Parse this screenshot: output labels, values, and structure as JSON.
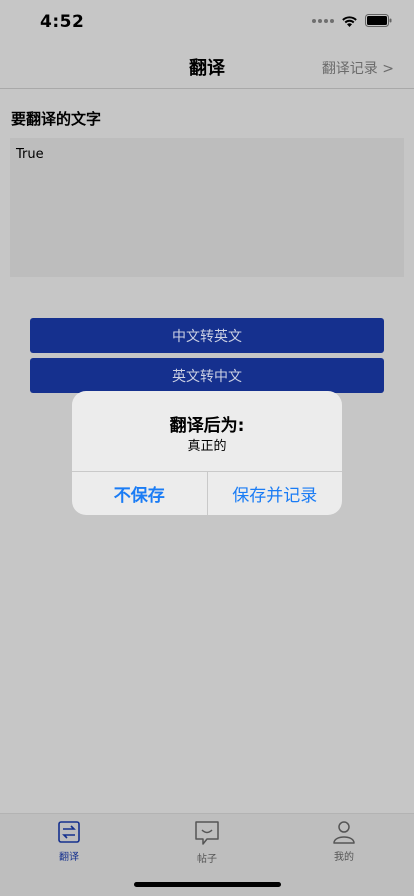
{
  "status_bar": {
    "time": "4:52"
  },
  "nav": {
    "title": "翻译",
    "right_link": "翻译记录 >"
  },
  "form": {
    "label": "要翻译的文字",
    "input_value": "True"
  },
  "buttons": {
    "zh_to_en": "中文转英文",
    "en_to_zh": "英文转中文"
  },
  "alert": {
    "title": "翻译后为:",
    "message": "真正的",
    "cancel_label": "不保存",
    "confirm_label": "保存并记录"
  },
  "tabs": [
    {
      "label": "翻译",
      "icon": "translate-icon",
      "active": true
    },
    {
      "label": "帖子",
      "icon": "chat-bubble-icon",
      "active": false
    },
    {
      "label": "我的",
      "icon": "person-icon",
      "active": false
    }
  ],
  "colors": {
    "primary": "#15308e",
    "alert_action": "#1a7cf5",
    "background": "#c6c6c6"
  }
}
